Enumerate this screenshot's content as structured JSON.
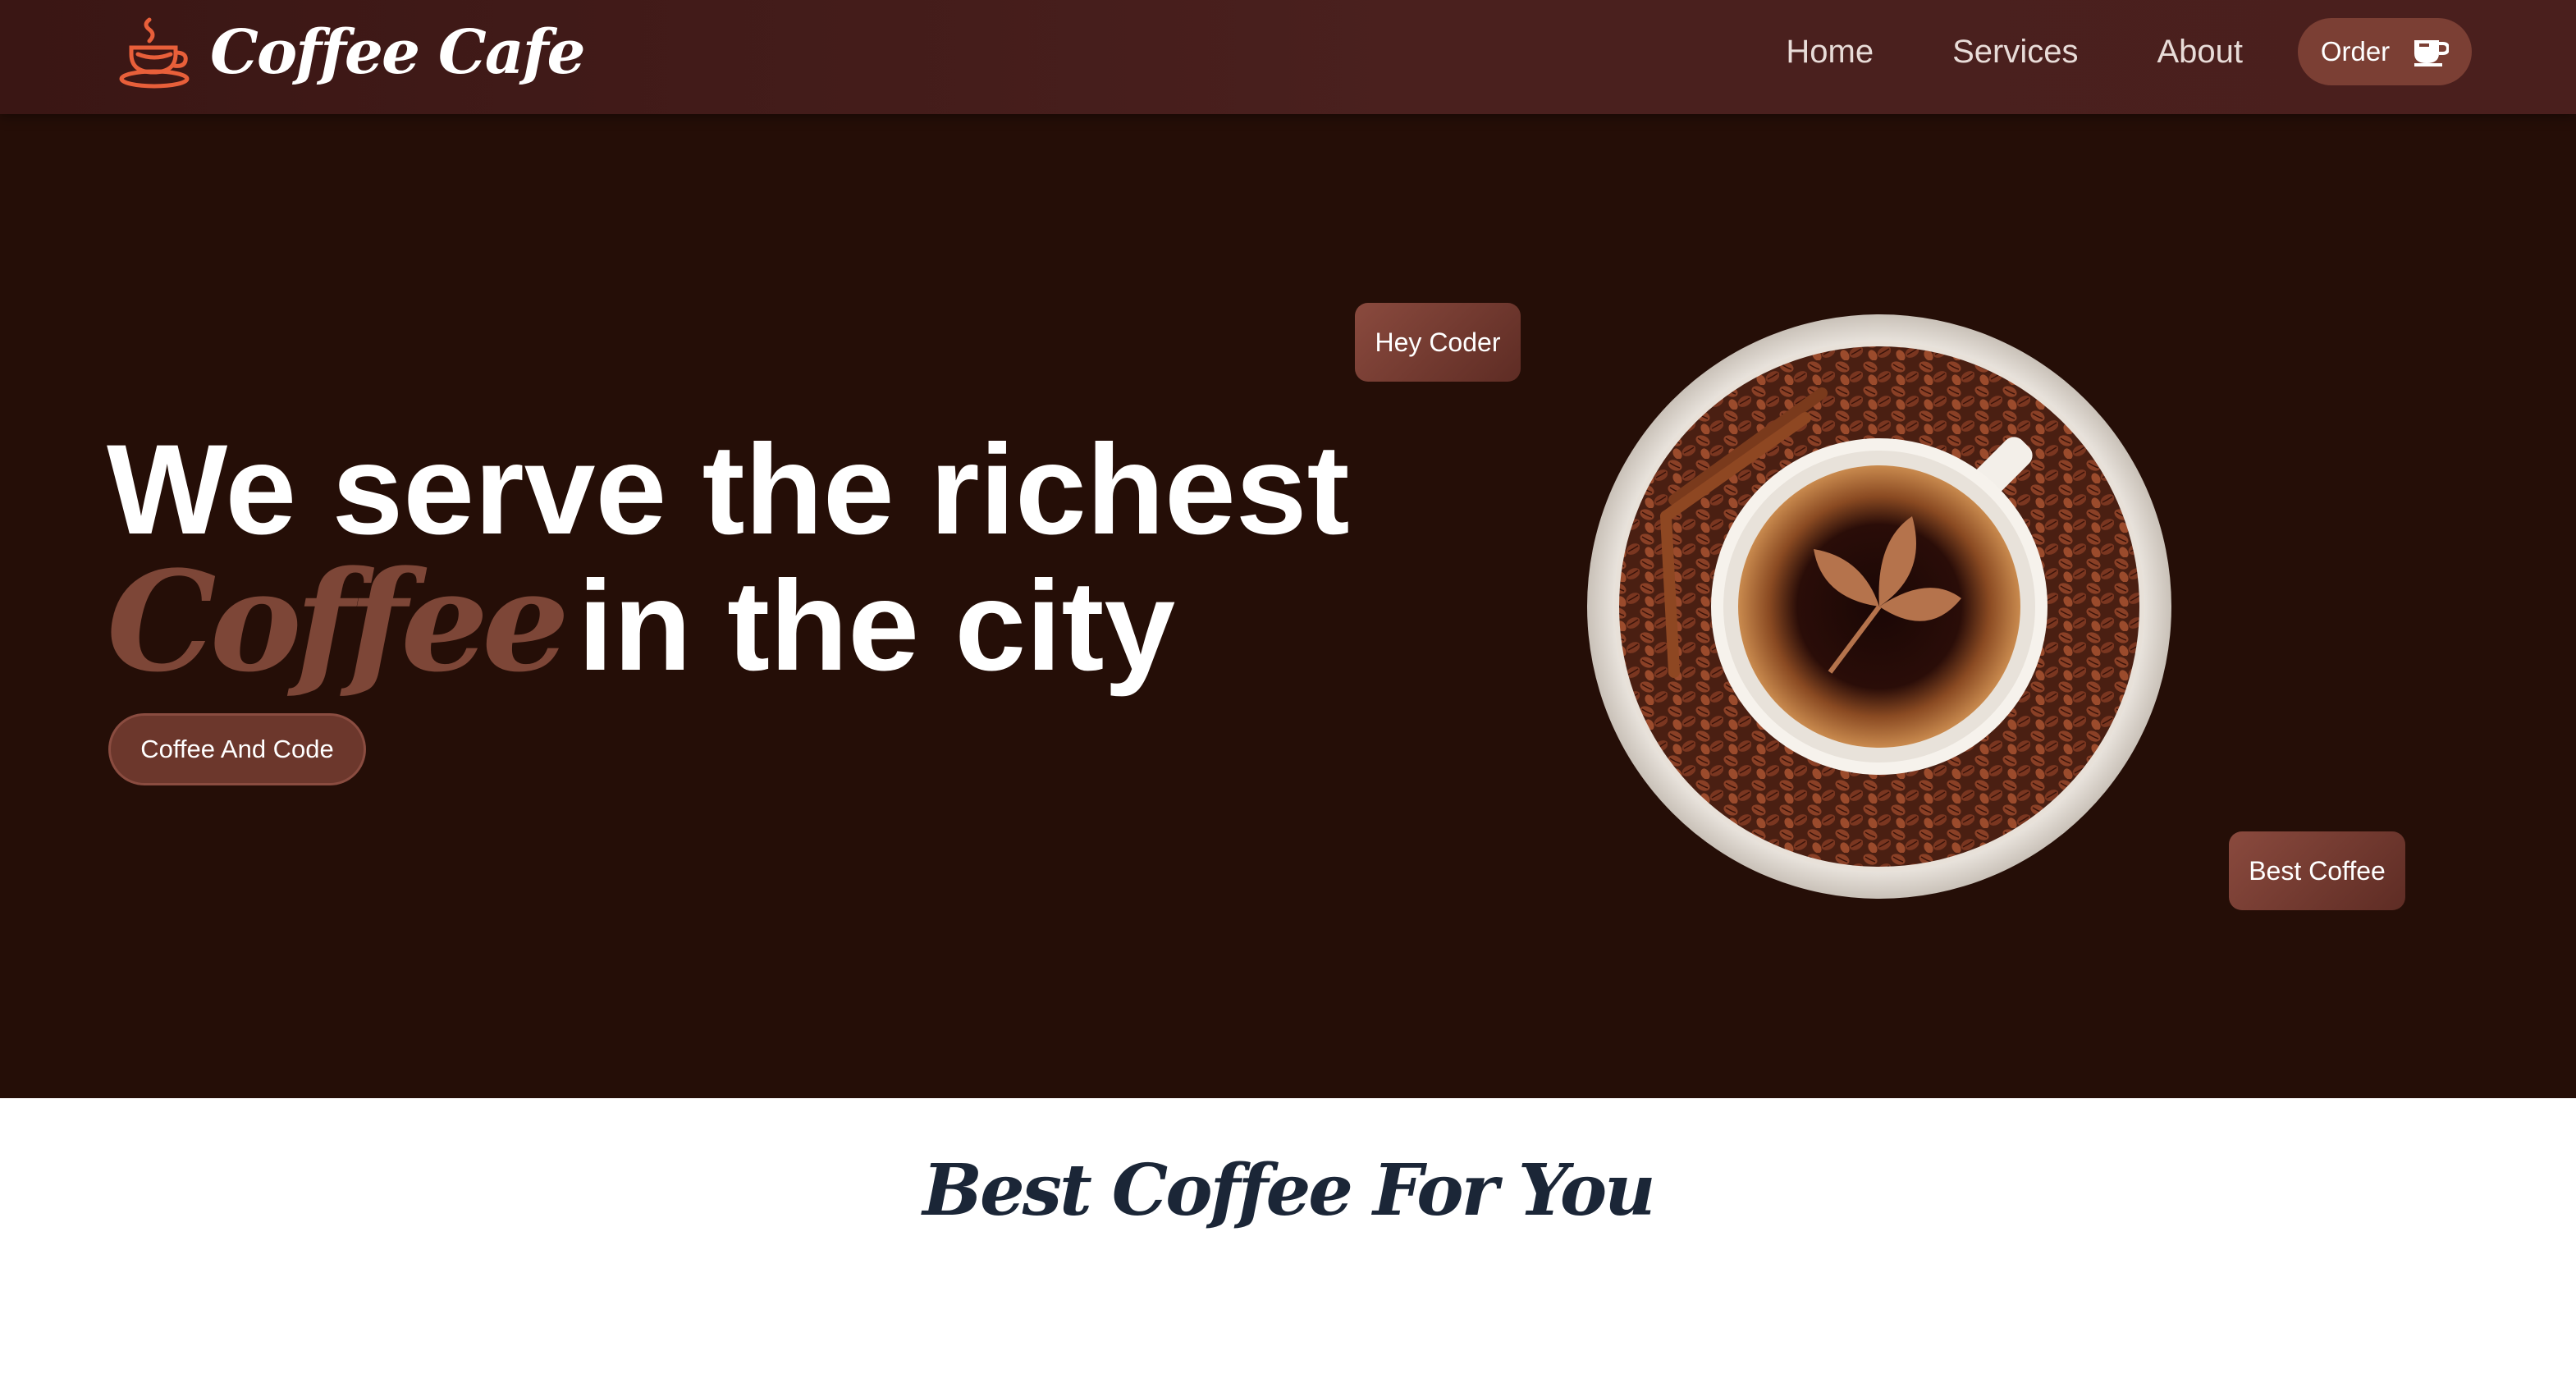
{
  "brand": {
    "name": "Coffee Cafe",
    "icon": "coffee-cup-icon",
    "icon_color": "#e85f3a"
  },
  "nav": {
    "links": [
      {
        "label": "Home"
      },
      {
        "label": "Services"
      },
      {
        "label": "About"
      }
    ],
    "order_label": "Order",
    "order_icon": "coffee-mug-icon"
  },
  "hero": {
    "headline_line1": "We serve the richest",
    "headline_accent": "Coffee",
    "headline_line2_rest": "in the city",
    "cta_label": "Coffee And Code",
    "tag_top": "Hey Coder",
    "tag_bottom": "Best Coffee",
    "image": "coffee-cup-with-beans-plate",
    "background_color": "#250e07",
    "accent_color": "#7d4637"
  },
  "section": {
    "title": "Best Coffee For You"
  }
}
